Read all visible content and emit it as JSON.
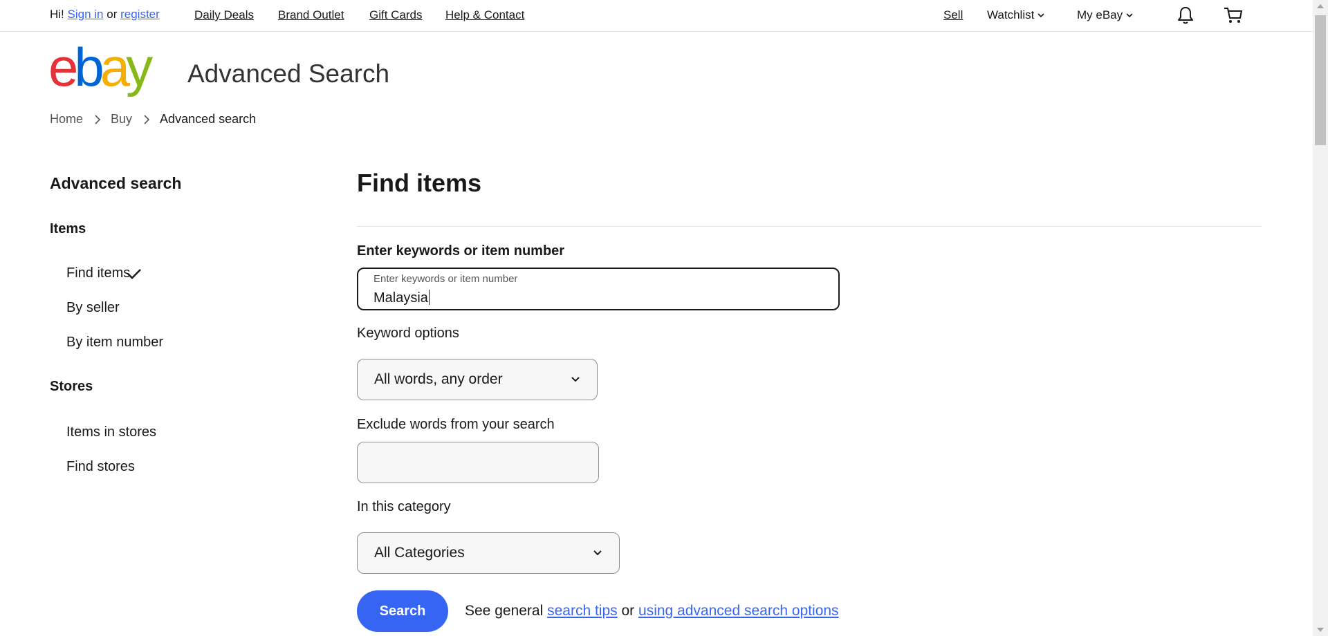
{
  "topbar": {
    "greeting": "Hi!",
    "sign_in": "Sign in",
    "or": "or",
    "register": "register",
    "nav": [
      "Daily Deals",
      "Brand Outlet",
      "Gift Cards",
      "Help & Contact"
    ],
    "sell": "Sell",
    "watchlist": "Watchlist",
    "my_ebay": "My eBay",
    "icons": [
      "bell-icon",
      "cart-icon"
    ]
  },
  "header": {
    "logo_text": "ebay",
    "logo_colors": [
      "#e53238",
      "#0064d2",
      "#f5af02",
      "#86b817"
    ],
    "title": "Advanced Search"
  },
  "breadcrumb": [
    "Home",
    "Buy",
    "Advanced search"
  ],
  "sidebar": {
    "title": "Advanced search",
    "sections": [
      {
        "label": "Items",
        "items": [
          "Find items",
          "By seller",
          "By item number"
        ],
        "selected": "Find items"
      },
      {
        "label": "Stores",
        "items": [
          "Items in stores",
          "Find stores"
        ]
      }
    ]
  },
  "main": {
    "title": "Find items",
    "keyword_heading": "Enter keywords or item number",
    "keyword_placeholder": "Enter keywords or item number",
    "keyword_value": "Malaysia",
    "keyword_options_label": "Keyword options",
    "keyword_options_value": "All words, any order",
    "exclude_label": "Exclude words from your search",
    "exclude_value": "",
    "category_label": "In this category",
    "category_value": "All Categories",
    "search_button": "Search",
    "tips_prefix": "See general",
    "tips_link": "search tips",
    "tips_or": "or",
    "advanced_link": "using advanced search options"
  },
  "colors": {
    "accent": "#3665f3",
    "text": "#191919"
  }
}
